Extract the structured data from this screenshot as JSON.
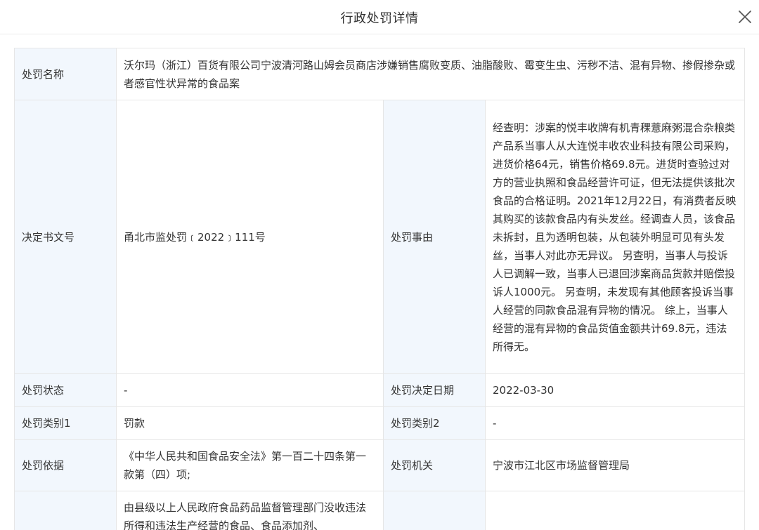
{
  "dialog": {
    "title": "行政处罚详情"
  },
  "fields": {
    "penalty_name": {
      "label": "处罚名称",
      "value": "沃尔玛（浙江）百货有限公司宁波清河路山姆会员商店涉嫌销售腐败变质、油脂酸败、霉变生虫、污秽不洁、混有异物、掺假掺杂或者感官性状异常的食品案"
    },
    "decision_no": {
      "label": "决定书文号",
      "value": "甬北市监处罚﹝2022﹞111号"
    },
    "reason": {
      "label": "处罚事由",
      "value": "经查明：涉案的悦丰收牌有机青稞薏麻粥混合杂粮类产品系当事人从大连悦丰收农业科技有限公司采购，进货价格64元，销售价格69.8元。进货时查验过对方的营业执照和食品经营许可证，但无法提供该批次食品的合格证明。2021年12月22日，有消费者反映其购买的该款食品内有头发丝。经调查人员，该食品未拆封，且为透明包装，从包装外明显可见有头发丝，当事人对此亦无异议。 另查明，当事人与投诉人已调解一致，当事人已退回涉案商品货款并赔偿投诉人1000元。 另查明，未发现有其他顾客投诉当事人经营的同款食品混有异物的情况。 综上，当事人经营的混有异物的食品货值金额共计69.8元，违法所得无。"
    },
    "status": {
      "label": "处罚状态",
      "value": "-"
    },
    "decision_date": {
      "label": "处罚决定日期",
      "value": "2022-03-30"
    },
    "category1": {
      "label": "处罚类别1",
      "value": "罚款"
    },
    "category2": {
      "label": "处罚类别2",
      "value": "-"
    },
    "basis": {
      "label": "处罚依据",
      "value": "《中华人民共和国食品安全法》第一百二十四条第一款第（四）项;"
    },
    "authority": {
      "label": "处罚机关",
      "value": "宁波市江北区市场监督管理局"
    },
    "result": {
      "label": "",
      "value": "由县级以上人民政府食品药品监督管理部门没收违法所得和违法生产经营的食品、食品添加剂、"
    }
  }
}
